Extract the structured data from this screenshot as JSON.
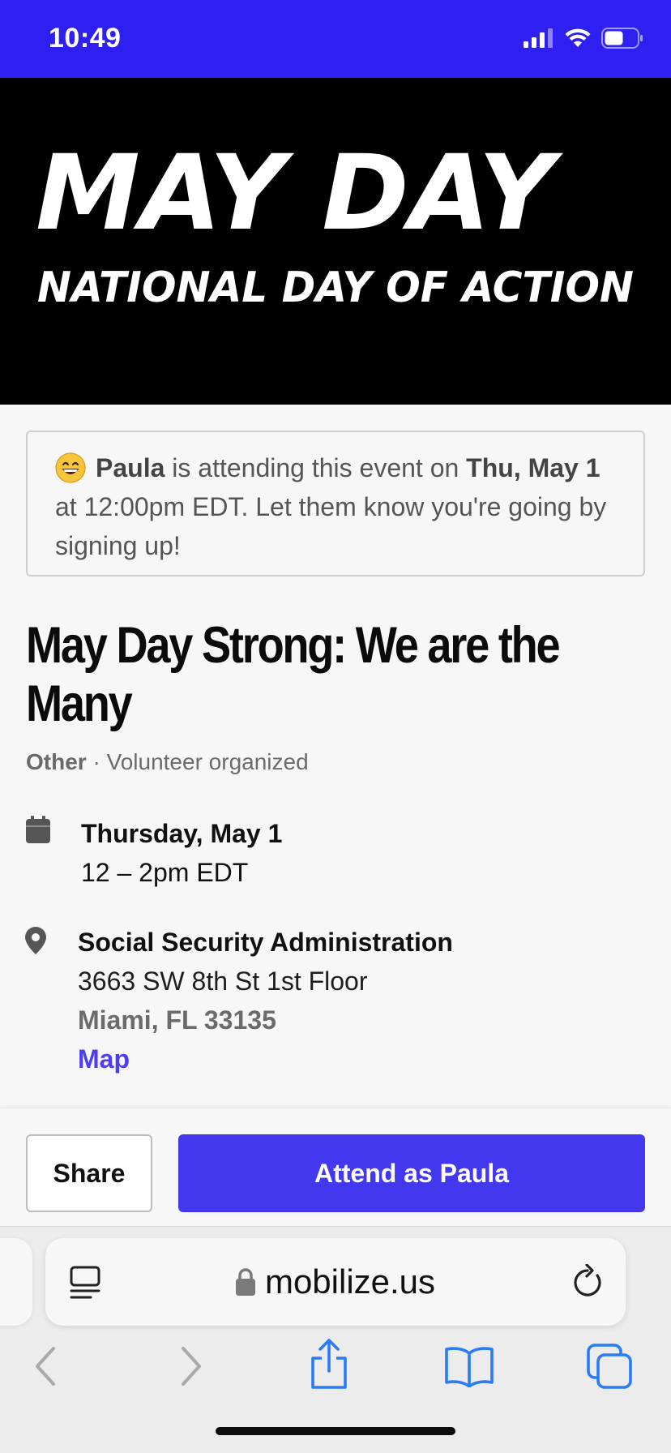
{
  "status_bar": {
    "time": "10:49"
  },
  "banner": {
    "headline": "MAY DAY",
    "subheadline": "NATIONAL DAY OF ACTION"
  },
  "notice": {
    "emoji_icon": "grinning-face-emoji",
    "name": "Paula",
    "text_middle": " is attending this event on ",
    "date": "Thu, May 1",
    "text_end": " at 12:00pm EDT. Let them know you're going by signing up!"
  },
  "event": {
    "title": "May Day Strong: We are the Many",
    "type": "Other",
    "separator": " · ",
    "organizer": "Volunteer organized",
    "date_title": "Thursday, May 1",
    "time_range": "12 – 2pm EDT",
    "location_name": "Social Security Administration",
    "address_line": "3663 SW 8th St 1st Floor",
    "city_line": "Miami, FL 33135",
    "map_link": "Map"
  },
  "actions": {
    "share_label": "Share",
    "attend_label": "Attend as Paula"
  },
  "browser": {
    "url": "mobilize.us",
    "icons": [
      "reader-icon",
      "lock-icon",
      "reload-icon",
      "back-icon",
      "forward-icon",
      "share-icon",
      "bookmarks-icon",
      "tabs-icon"
    ]
  },
  "colors": {
    "status_bar": "#2d20f0",
    "primary_button": "#4438ee",
    "link": "#4a3ef0",
    "banner_bg": "#000000",
    "toolbar_icons": "#2a7cf6"
  }
}
